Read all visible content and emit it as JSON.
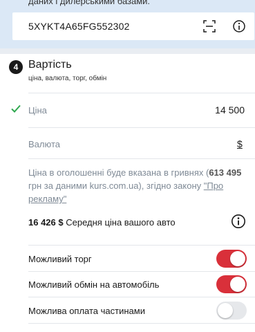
{
  "vin_block": {
    "hint_text": "даних і дилерськими базами.",
    "vin_value": "5XYKT4A65FG552302"
  },
  "section": {
    "step_number": "4",
    "title": "Вартість",
    "subtitle": "ціна, валюта, торг, обмін"
  },
  "price": {
    "label": "Ціна",
    "value": "14 500"
  },
  "currency": {
    "label": "Валюта",
    "value": "$"
  },
  "note": {
    "text_before": "Ціна в оголошенні буде вказана в гривнях (",
    "uah_amount": "613 495",
    "text_after": " грн за даними kurs.com.ua), згідно закону ",
    "link_text": "\"Про рекламу\""
  },
  "average_price": {
    "value": "16 426 $",
    "label": "Середня ціна вашого авто"
  },
  "options": [
    {
      "label": "Можливий торг",
      "enabled": true
    },
    {
      "label": "Можливий обмін на автомобіль",
      "enabled": true
    },
    {
      "label": "Можлива оплата частинами",
      "enabled": false
    }
  ],
  "colors": {
    "accent_red": "#d9303a",
    "check_green": "#2fa84f",
    "card_blue": "#dbe8f6"
  },
  "icons": {
    "scan": "scan-icon",
    "info": "info-icon",
    "check": "check-icon"
  }
}
